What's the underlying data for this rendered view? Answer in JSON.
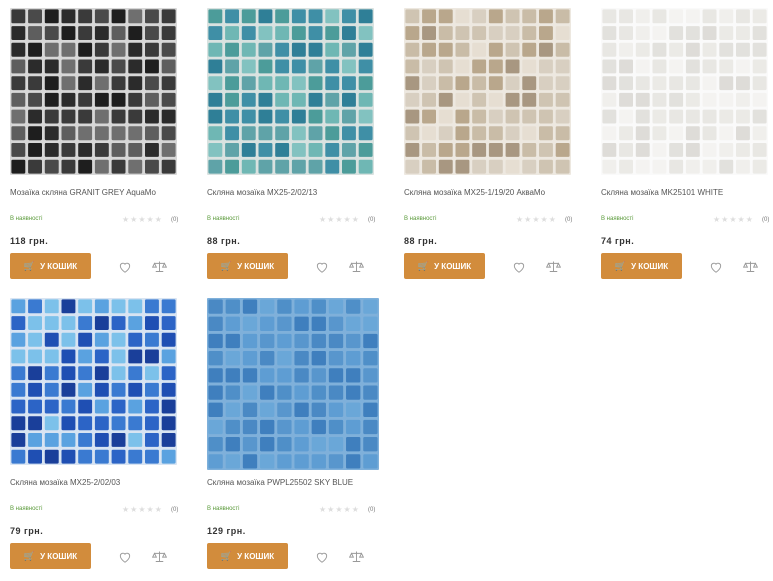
{
  "products": [
    {
      "title": "Мозаїка скляна GRANIT GREY AquaMo",
      "stock": "В наявності",
      "rating": "(0)",
      "price": "118 грн.",
      "buy_label": "У КОШИК",
      "palette": [
        "#1e1e1e",
        "#2b2b2b",
        "#3a3a3a",
        "#4a4a4a",
        "#5e5e5e",
        "#6f6f6f"
      ],
      "grout": "#d7d7d7"
    },
    {
      "title": "Скляна мозаїка MX25-2/02/13",
      "stock": "В наявності",
      "rating": "(0)",
      "price": "88 грн.",
      "buy_label": "У КОШИК",
      "palette": [
        "#5fa3a8",
        "#6fb7b4",
        "#3f8fa6",
        "#82c2c0",
        "#4c9c9a",
        "#2f7f97"
      ],
      "grout": "#d9e2e0"
    },
    {
      "title": "Скляна мозаїка MX25-1/19/20 АкваМо",
      "stock": "В наявності",
      "rating": "(0)",
      "price": "88 грн.",
      "buy_label": "У КОШИК",
      "palette": [
        "#d8cfc1",
        "#c9bca7",
        "#b9a78c",
        "#e6ded2",
        "#a89781",
        "#cfc4b2"
      ],
      "grout": "#ede8e0"
    },
    {
      "title": "Скляна мозаїка MK25101 WHITE",
      "stock": "В наявності",
      "rating": "(0)",
      "price": "74 грн.",
      "buy_label": "У КОШИК",
      "palette": [
        "#f0efec",
        "#e8e7e3",
        "#f4f3f1",
        "#e2e1dd",
        "#ebeae6",
        "#dedcd8"
      ],
      "grout": "#fafafa"
    },
    {
      "title": "Скляна мозаїка MX25-2/02/03",
      "stock": "В наявності",
      "rating": "(0)",
      "price": "79 грн.",
      "buy_label": "У КОШИК",
      "palette": [
        "#1f4fb3",
        "#3a7ad1",
        "#5aa2e0",
        "#2c64c6",
        "#7cc1ea",
        "#1a3f9a"
      ],
      "grout": "#d8e4f2"
    },
    {
      "title": "Скляна мозаїка PWPL25502 SKY BLUE",
      "stock": "В наявності",
      "rating": "(0)",
      "price": "129 грн.",
      "buy_label": "У КОШИК",
      "palette": [
        "#4f8fc8",
        "#5e9dd3",
        "#3f7fbe",
        "#6aa7d8",
        "#4a89c4",
        "#5896cd"
      ],
      "grout": "#7fb0da"
    }
  ]
}
